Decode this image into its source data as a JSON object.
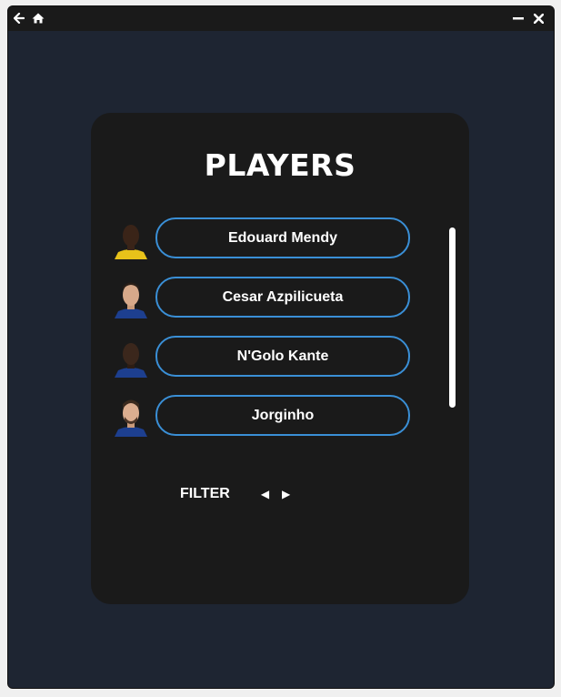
{
  "titlebar": {
    "back_icon": "arrow-left-icon",
    "home_icon": "home-icon",
    "minimize_icon": "minimize-icon",
    "close_icon": "close-icon"
  },
  "panel": {
    "title": "PLAYERS",
    "players": [
      {
        "name": "Edouard Mendy",
        "kit": "#e8c21a"
      },
      {
        "name": "Cesar Azpilicueta",
        "kit": "#1d3f8f"
      },
      {
        "name": "N'Golo Kante",
        "kit": "#1d3f8f"
      },
      {
        "name": "Jorginho",
        "kit": "#1d3f8f"
      }
    ]
  },
  "filter": {
    "label": "FILTER",
    "prev_glyph": "◀",
    "next_glyph": "▶"
  },
  "colors": {
    "background": "#1e2532",
    "panel": "#1a1a1a",
    "accent": "#3a8fd6"
  }
}
